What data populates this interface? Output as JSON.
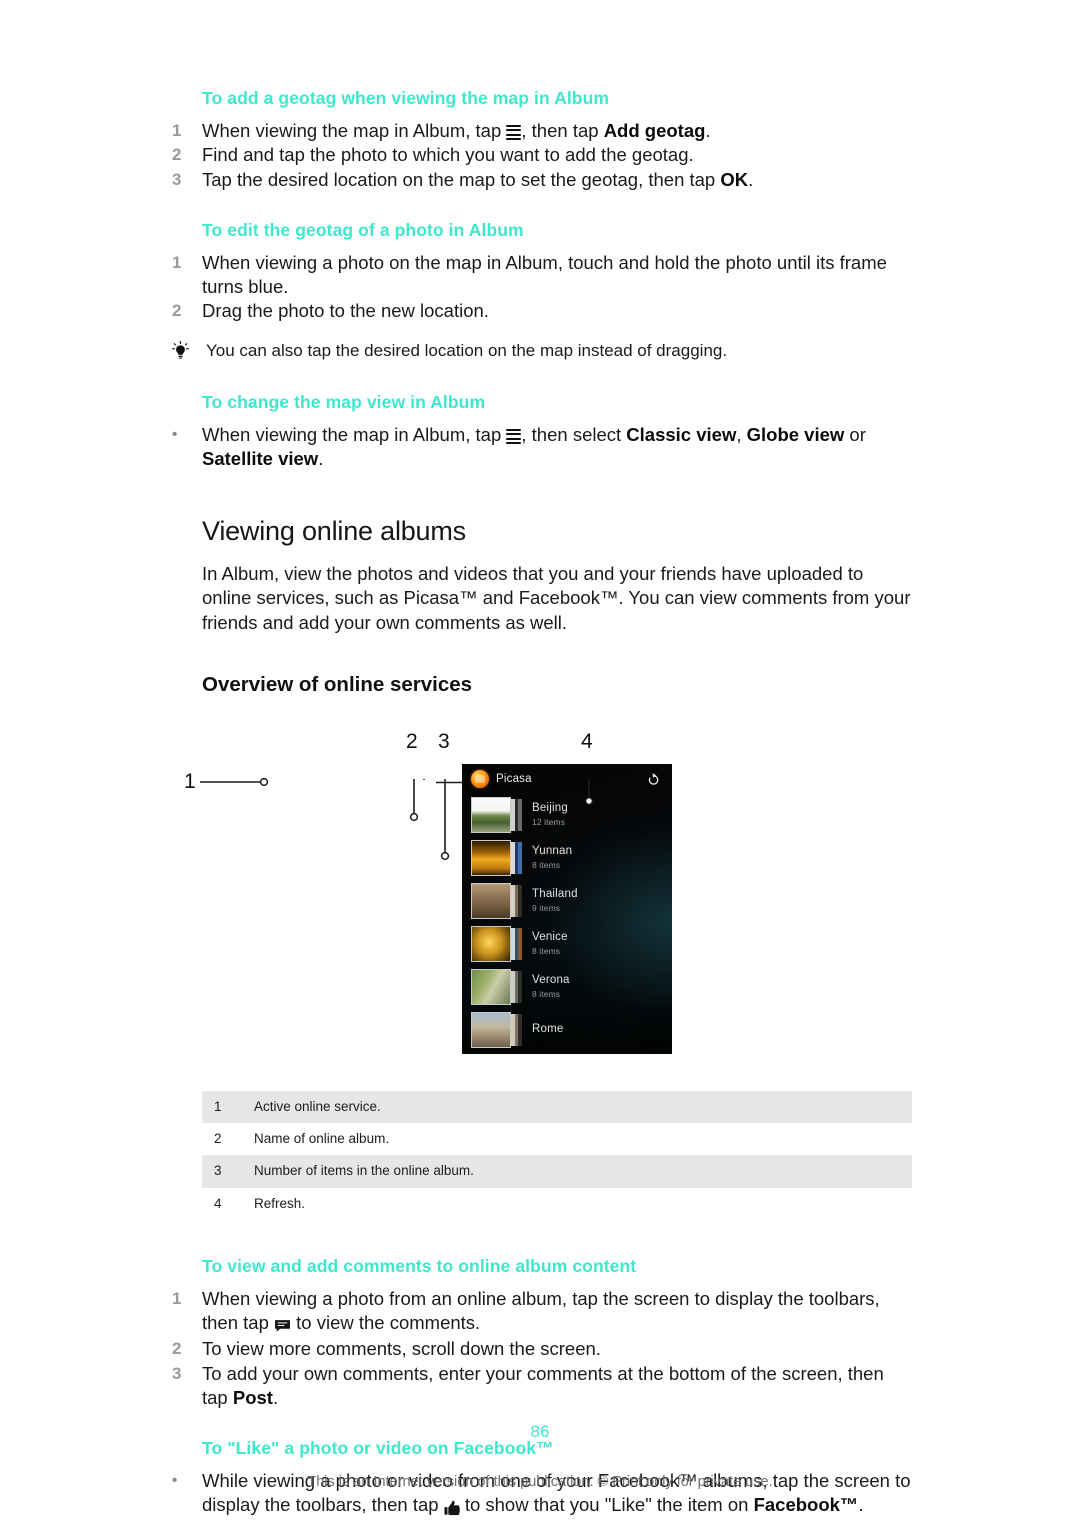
{
  "document": {
    "page_number": "86",
    "footer": "This is an Internet version of this publication. © Print only for private use."
  },
  "sections": [
    {
      "id": "add-geotag",
      "heading": "To add a geotag when viewing the map in Album",
      "steps": [
        {
          "marker": "1",
          "parts": [
            "When viewing the map in Album, tap ",
            "[menu-icon]",
            ", then tap ",
            {
              "b": "Add geotag"
            },
            "."
          ]
        },
        {
          "marker": "2",
          "parts": [
            "Find and tap the photo to which you want to add the geotag."
          ]
        },
        {
          "marker": "3",
          "parts": [
            "Tap the desired location on the map to set the geotag, then tap ",
            {
              "b": "OK"
            },
            "."
          ]
        }
      ]
    },
    {
      "id": "edit-geotag",
      "heading": "To edit the geotag of a photo in Album",
      "steps": [
        {
          "marker": "1",
          "parts": [
            "When viewing a photo on the map in Album, touch and hold the photo until its frame turns blue."
          ]
        },
        {
          "marker": "2",
          "parts": [
            "Drag the photo to the new location."
          ]
        }
      ],
      "tip": "You can also tap the desired location on the map instead of dragging."
    },
    {
      "id": "change-map-view",
      "heading": "To change the map view in Album",
      "steps": [
        {
          "marker": "•",
          "parts": [
            "When viewing the map in Album, tap ",
            "[menu-icon]",
            ", then select ",
            {
              "b": "Classic view"
            },
            ", ",
            {
              "b": "Globe view"
            },
            " or ",
            {
              "b": "Satellite view"
            },
            "."
          ]
        }
      ]
    }
  ],
  "viewing_online_albums": {
    "heading": "Viewing online albums",
    "paragraph": "In Album, view the photos and videos that you and your friends have uploaded to online services, such as Picasa™ and Facebook™. You can view comments from your friends and add your own comments as well."
  },
  "overview": {
    "heading": "Overview of online services",
    "figure": {
      "callout_numbers": [
        "1",
        "2",
        "3",
        "4"
      ],
      "screenshot": {
        "service_name": "Picasa",
        "service_icon": "picasa-logo-icon",
        "refresh_icon": "refresh-icon",
        "albums": [
          {
            "name": "Beijing",
            "items": "12 items"
          },
          {
            "name": "Yunnan",
            "items": "8 items"
          },
          {
            "name": "Thailand",
            "items": "9 items"
          },
          {
            "name": "Venice",
            "items": "8 items"
          },
          {
            "name": "Verona",
            "items": "8 items"
          },
          {
            "name": "Rome",
            "items": ""
          }
        ]
      }
    },
    "legend": [
      {
        "num": "1",
        "text": "Active online service."
      },
      {
        "num": "2",
        "text": "Name of online album."
      },
      {
        "num": "3",
        "text": "Number of items in the online album."
      },
      {
        "num": "4",
        "text": "Refresh."
      }
    ]
  },
  "comments_section": {
    "heading": "To view and add comments to online album content",
    "steps": [
      {
        "marker": "1",
        "parts": [
          "When viewing a photo from an online album, tap the screen to display the toolbars, then tap ",
          "[comment-icon]",
          " to view the comments."
        ]
      },
      {
        "marker": "2",
        "parts": [
          "To view more comments, scroll down the screen."
        ]
      },
      {
        "marker": "3",
        "parts": [
          "To add your own comments, enter your comments at the bottom of the screen, then tap ",
          {
            "b": "Post"
          },
          "."
        ]
      }
    ]
  },
  "like_section": {
    "heading": "To \"Like\" a photo or video on Facebook™",
    "steps": [
      {
        "marker": "•",
        "parts": [
          "While viewing a photo or video from one of your Facebook™ albums, tap the screen to display the toolbars, then tap ",
          "[thumb-icon]",
          " to show that you \"Like\" the item on ",
          {
            "b": "Facebook™"
          },
          "."
        ]
      }
    ]
  },
  "colors": {
    "heading_teal": "#3ee8cd",
    "body_text": "#1a1a1a",
    "marker_gray": "#999999",
    "legend_row_alt": "#e6e6e6",
    "footer_gray": "#6e6e6e",
    "picasa_orange": "#ff9e18"
  }
}
